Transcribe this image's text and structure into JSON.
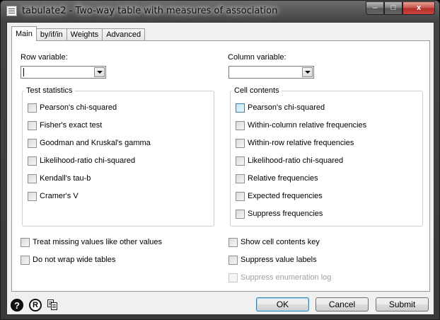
{
  "window": {
    "title": "tabulate2 - Two-way table with measures of association",
    "minimize_glyph": "–",
    "maximize_glyph": "□",
    "close_glyph": "x"
  },
  "tabs": [
    {
      "label": "Main",
      "active": true
    },
    {
      "label": "by/if/in",
      "active": false
    },
    {
      "label": "Weights",
      "active": false
    },
    {
      "label": "Advanced",
      "active": false
    }
  ],
  "row_variable": {
    "label": "Row variable:",
    "value": ""
  },
  "column_variable": {
    "label": "Column variable:",
    "value": ""
  },
  "test_statistics": {
    "title": "Test statistics",
    "items": [
      "Pearson's chi-squared",
      "Fisher's exact test",
      "Goodman and Kruskal's gamma",
      "Likelihood-ratio chi-squared",
      "Kendall's tau-b",
      "Cramer's V"
    ]
  },
  "cell_contents": {
    "title": "Cell contents",
    "items": [
      "Pearson's chi-squared",
      "Within-column relative frequencies",
      "Within-row relative frequencies",
      "Likelihood-ratio chi-squared",
      "Relative frequencies",
      "Expected frequencies",
      "Suppress frequencies"
    ]
  },
  "options_left": [
    "Treat missing values like other values",
    "Do not wrap wide tables"
  ],
  "options_right": [
    "Show cell contents key",
    "Suppress value labels",
    "Suppress enumeration log"
  ],
  "footer": {
    "help_glyph": "?",
    "reset_glyph": "R",
    "icons": [
      "help-icon",
      "reset-icon",
      "copy-icon"
    ],
    "ok": "OK",
    "cancel": "Cancel",
    "submit": "Submit"
  }
}
